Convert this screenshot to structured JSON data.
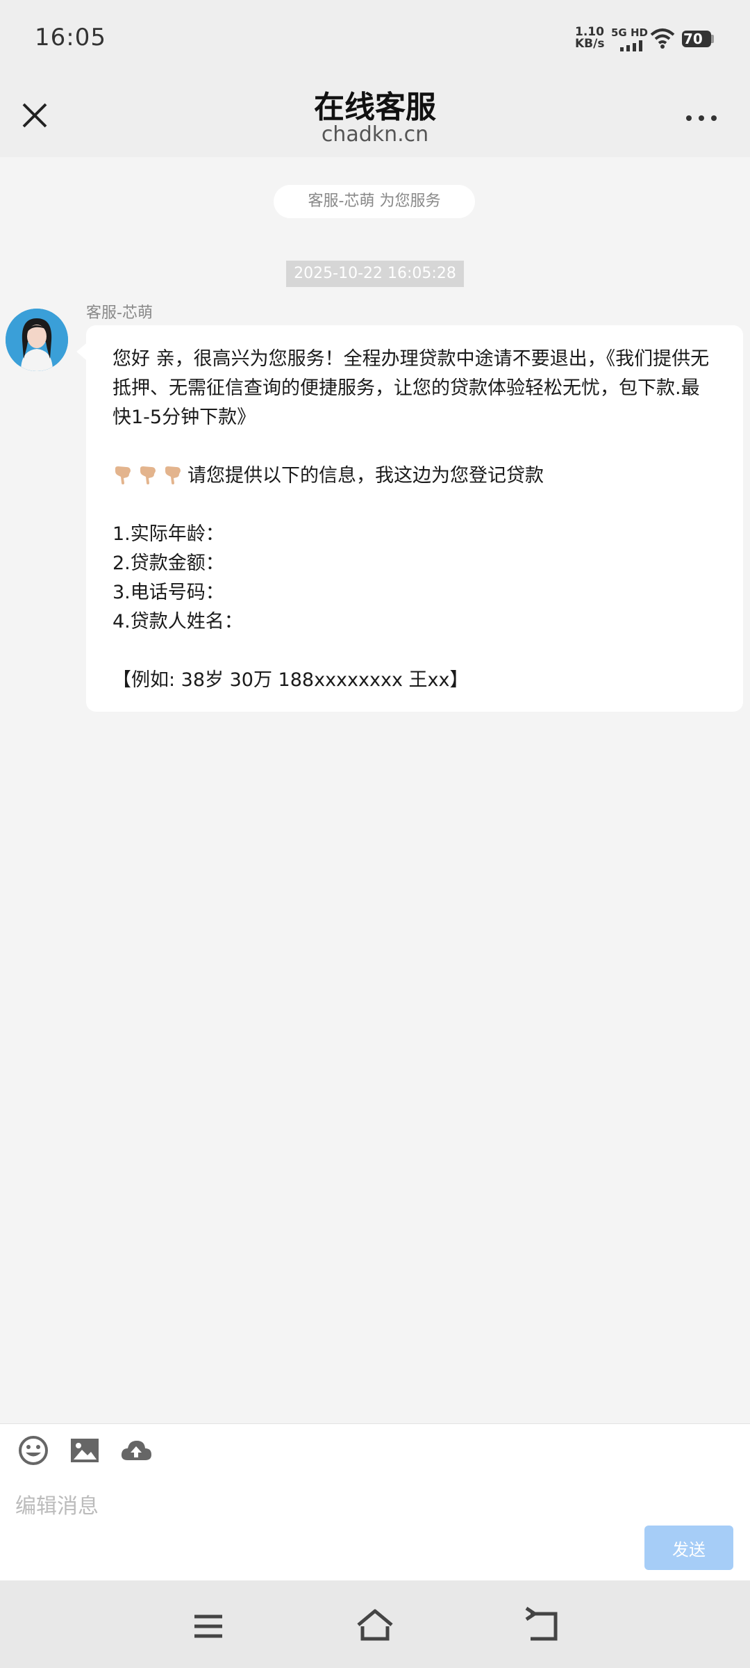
{
  "status_bar": {
    "time": "16:05",
    "speed_value": "1.10",
    "speed_unit": "KB/s",
    "network": "5G HD",
    "battery": "70"
  },
  "header": {
    "title": "在线客服",
    "subtitle": "chadkn.cn",
    "close_icon": "close-icon",
    "more_icon": "more-icon"
  },
  "chat": {
    "service_notice": "客服-芯萌 为您服务",
    "timestamp": "2025-10-22 16:05:28",
    "agent_name": "客服-芯萌",
    "message": {
      "line1": "您好 亲，很高兴为您服务！全程办理贷款中途请不要退出，《我们提供无抵押、无需征信查询的便捷服务，让您的贷款体验轻松无忧，包下款.最快1-5分钟下款》",
      "line2": "请您提供以下的信息，我这边为您登记贷款",
      "items": [
        "1.实际年龄：",
        "2.贷款金额：",
        "3.电话号码：",
        "4.贷款人姓名："
      ],
      "example": "【例如: 38岁 30万 188xxxxxxxx 王xx】"
    }
  },
  "composer": {
    "placeholder": "编辑消息",
    "send_label": "发送",
    "tools": [
      "emoji-icon",
      "image-icon",
      "upload-cloud-icon"
    ]
  },
  "navbar": {
    "icons": [
      "menu-icon",
      "home-icon",
      "back-icon"
    ]
  },
  "colors": {
    "accent_send": "#a6cdf7",
    "background": "#f4f4f4",
    "header_bg": "#eeeeee"
  }
}
